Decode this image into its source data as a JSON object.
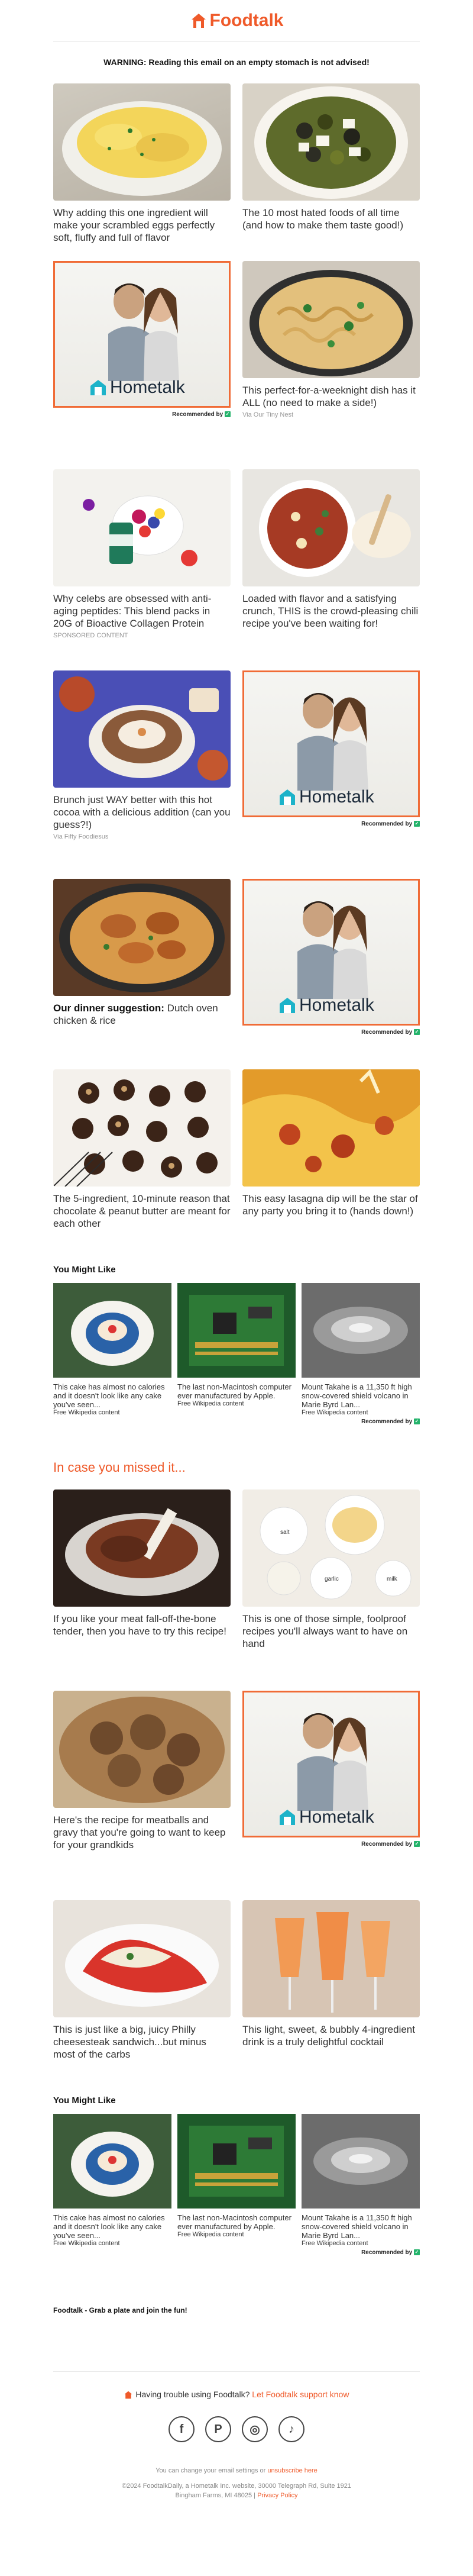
{
  "header": {
    "logo_text": "Foodtalk",
    "warning": "WARNING: Reading this email on an empty stomach is not advised!"
  },
  "ad": {
    "brand": "Hometalk",
    "recommended_label": "Recommended by"
  },
  "section1": [
    {
      "left": {
        "caption": "Why adding this one ingredient will make your scrambled eggs perfectly soft, fluffy and full of flavor",
        "image": "scrambled-eggs-bowl"
      },
      "right": {
        "caption": "The 10 most hated foods of all time (and how to make them taste good!)",
        "image": "olives-feta-bowl"
      }
    },
    {
      "left": {
        "ad": true
      },
      "right": {
        "caption": "This perfect-for-a-weeknight dish has it ALL (no need to make a side!)",
        "via": "Via Our Tiny Nest",
        "image": "pasta-skillet"
      }
    },
    {
      "left": {
        "caption": "Why celebs are obsessed with anti-aging peptides: This blend packs in 20G of Bioactive Collagen Protein",
        "via": "SPONSORED CONTENT",
        "image": "collagen-bowl"
      },
      "right": {
        "caption": "Loaded with flavor and a satisfying crunch, THIS is the crowd-pleasing chili recipe you've been waiting for!",
        "image": "chili-bowl"
      }
    },
    {
      "left": {
        "caption": "Brunch just WAY better with this hot cocoa with a delicious addition (can you guess?!)",
        "via": "Via Fifty Foodiesus",
        "image": "hot-cocoa-mug"
      },
      "right": {
        "ad": true
      }
    },
    {
      "left": {
        "caption_bold": "Our dinner suggestion:",
        "caption": " Dutch oven chicken & rice",
        "image": "chicken-rice-pan"
      },
      "right": {
        "ad": true
      }
    },
    {
      "left": {
        "caption": "The 5-ingredient, 10-minute reason that chocolate & peanut butter are meant for each other",
        "image": "chocolate-bonbons"
      },
      "right": {
        "caption": "This easy lasagna dip will be the star of any party you bring it to (hands down!)",
        "image": "lasagna-dip"
      }
    }
  ],
  "you_might_like": {
    "title": "You Might Like",
    "items": [
      {
        "caption": "This cake has almost no calories and it doesn't look like any cake you've seen...",
        "source": "Free Wikipedia content",
        "image": "plate-of-cake"
      },
      {
        "caption": "The last non-Macintosh computer ever manufactured by Apple.",
        "source": "Free Wikipedia content",
        "image": "circuit-board"
      },
      {
        "caption": "Mount Takahe is a 11,350 ft high snow-covered shield volcano in Marie Byrd Lan...",
        "source": "Free Wikipedia content",
        "image": "volcano-aerial"
      }
    ]
  },
  "missed": {
    "title": "In case you missed it...",
    "rows": [
      {
        "left": {
          "caption": "If you like your meat fall-off-the-bone tender, then you have to try this recipe!",
          "image": "braised-meat"
        },
        "right": {
          "caption": "This is one of those simple, foolproof recipes you'll always want to have on hand",
          "image": "ingredients-bowls",
          "labels": [
            "salt",
            "milk",
            "garlic"
          ]
        }
      },
      {
        "left": {
          "caption": "Here's the recipe for meatballs and gravy that you're going to want to keep for your grandkids",
          "image": "meatballs-gravy"
        },
        "right": {
          "ad": true
        }
      },
      {
        "left": {
          "caption": "This is just like a big, juicy Philly cheesesteak sandwich...but minus most of the carbs",
          "image": "stuffed-peppers"
        },
        "right": {
          "caption": "This light, sweet, & bubbly 4-ingredient drink is a truly delightful cocktail",
          "image": "cocktail-glasses"
        }
      }
    ]
  },
  "footer": {
    "tagline": "Foodtalk - Grab a plate and join the fun!",
    "trouble_text": "Having trouble using Foodtalk?",
    "trouble_link": "Let Foodtalk support know",
    "socials": [
      {
        "label": "f",
        "icon": "facebook-icon"
      },
      {
        "label": "P",
        "icon": "pinterest-icon"
      },
      {
        "label": "◎",
        "icon": "instagram-icon"
      },
      {
        "label": "♪",
        "icon": "tiktok-icon"
      }
    ],
    "settings_text": "You can change your email settings or",
    "unsubscribe": "unsubscribe here",
    "copyright": "©2024 FoodtalkDaily, a Hometalk Inc. website, 30000 Telegraph Rd, Suite 1921",
    "address": "Bingham Farms, MI 48025 |",
    "privacy": "Privacy Policy"
  },
  "colors": {
    "accent": "#ef5a2a",
    "ad_border": "#f06b36",
    "recommended_badge": "#24b36b"
  }
}
